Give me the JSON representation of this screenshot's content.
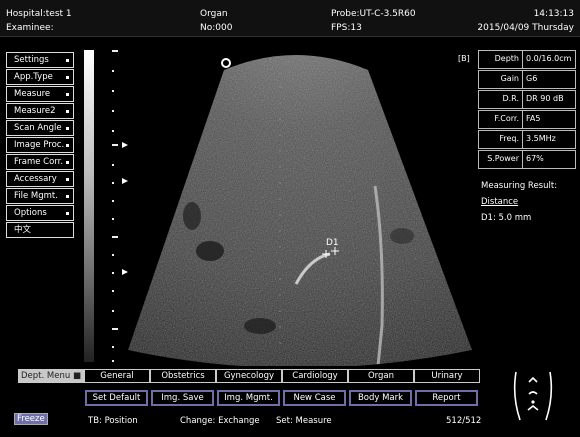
{
  "header": {
    "hospital": "Hospital:test 1",
    "examinee": "Examinee:",
    "organ": "Organ",
    "number": "No:000",
    "probe": "Probe:UT-C-3.5R60",
    "fps": "FPS:13",
    "time": "14:13:13",
    "date": "2015/04/09 Thursday"
  },
  "menu": {
    "items": [
      {
        "label": "Settings"
      },
      {
        "label": "App.Type"
      },
      {
        "label": "Measure"
      },
      {
        "label": "Measure2"
      },
      {
        "label": "Scan Angle"
      },
      {
        "label": "Image Proc."
      },
      {
        "label": "Frame Corr."
      },
      {
        "label": "Accessary"
      },
      {
        "label": "File Mgmt."
      },
      {
        "label": "Options"
      },
      {
        "label": "中文"
      }
    ]
  },
  "image": {
    "mode_label": "[B]",
    "marker_label": "D1"
  },
  "params": [
    {
      "key": "Depth",
      "value": "0.0/16.0cm"
    },
    {
      "key": "Gain",
      "value": "G6"
    },
    {
      "key": "D.R.",
      "value": "DR 90 dB"
    },
    {
      "key": "F.Corr.",
      "value": "FA5"
    },
    {
      "key": "Freq.",
      "value": "3.5MHz"
    },
    {
      "key": "S.Power",
      "value": "67%"
    }
  ],
  "measurement": {
    "title": "Measuring Result:",
    "type": "Distance",
    "result": "D1: 5.0 mm"
  },
  "dept_tabs": {
    "menu_label": "Dept. Menu",
    "tabs": [
      "General",
      "Obstetrics",
      "Gynecology",
      "Cardiology",
      "Organ",
      "Urinary"
    ]
  },
  "function_buttons": [
    "Set Default",
    "Img. Save",
    "Img. Mgmt.",
    "New Case",
    "Body Mark",
    "Report"
  ],
  "status_bar": {
    "freeze": "Freeze",
    "tb": "TB: Position",
    "change": "Change: Exchange",
    "set": "Set: Measure",
    "frames": "512/512"
  }
}
